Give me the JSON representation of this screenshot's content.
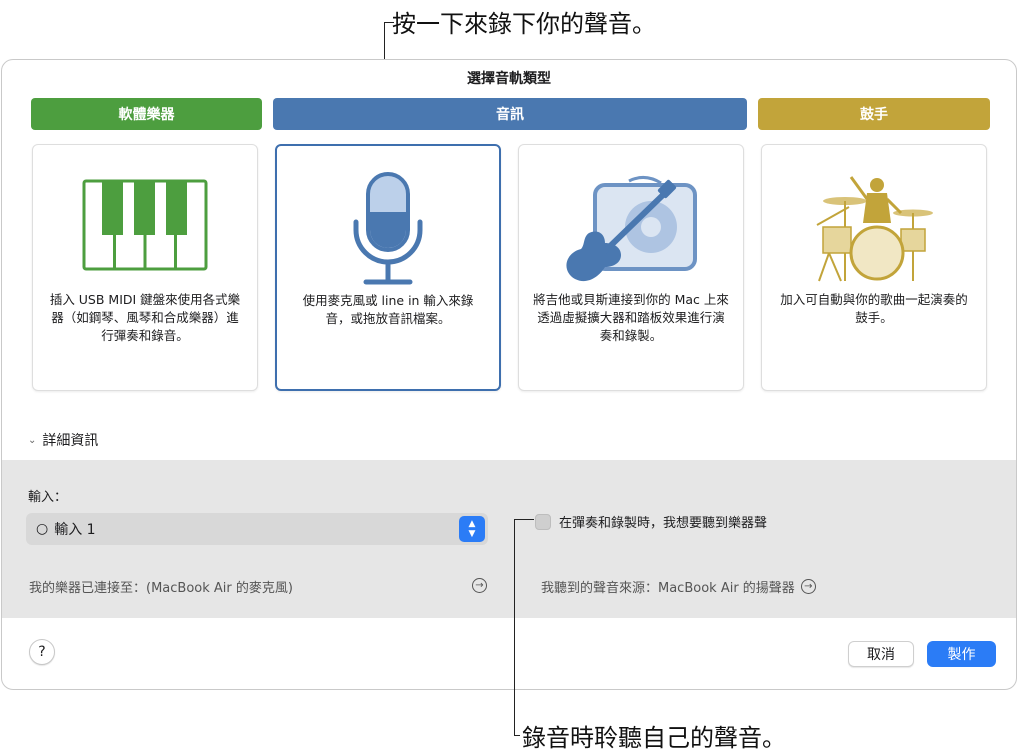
{
  "callouts": {
    "top": "按一下來錄下你的聲音。",
    "bottom": "錄音時聆聽自己的聲音。"
  },
  "dialog": {
    "title": "選擇音軌類型",
    "categories": [
      {
        "label": "軟體樂器",
        "color": "#4d9e3f"
      },
      {
        "label": "音訊",
        "color": "#4a78b0"
      },
      {
        "label": "鼓手",
        "color": "#c2a43a"
      }
    ],
    "cards": [
      {
        "icon": "piano-keys-icon",
        "description": "插入 USB MIDI 鍵盤來使用各式樂器（如鋼琴、風琴和合成樂器）進行彈奏和錄音。"
      },
      {
        "icon": "microphone-icon",
        "description": "使用麥克風或 line in 輸入來錄音，或拖放音訊檔案。",
        "selected": true
      },
      {
        "icon": "guitar-amp-icon",
        "description": "將吉他或貝斯連接到你的 Mac 上來透過虛擬擴大器和踏板效果進行演奏和錄製。"
      },
      {
        "icon": "drummer-icon",
        "description": "加入可自動與你的歌曲一起演奏的鼓手。"
      }
    ],
    "details": {
      "toggle_label": "詳細資訊",
      "input_label": "輸入：",
      "input_value": "輸入 1",
      "monitor_label": "在彈奏和錄製時，我想要聽到樂器聲",
      "monitor_checked": false,
      "instrument_route": "我的樂器已連接至：(MacBook Air 的麥克風)",
      "output_route": "我聽到的聲音來源：MacBook Air 的揚聲器"
    },
    "buttons": {
      "help": "?",
      "cancel": "取消",
      "create": "製作"
    }
  }
}
